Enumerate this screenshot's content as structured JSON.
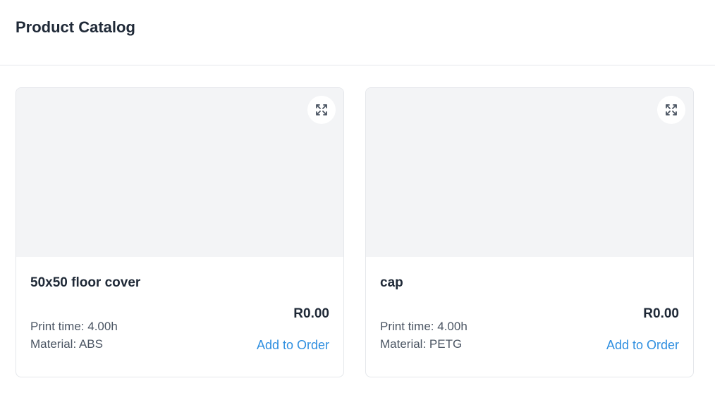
{
  "header": {
    "title": "Product Catalog"
  },
  "products": [
    {
      "name": "50x50 floor cover",
      "print_time": "Print time: 4.00h",
      "material": "Material: ABS",
      "price": "R0.00",
      "action_label": "Add to Order",
      "expand_icon": "expand-icon"
    },
    {
      "name": "cap",
      "print_time": "Print time: 4.00h",
      "material": "Material: PETG",
      "price": "R0.00",
      "action_label": "Add to Order",
      "expand_icon": "expand-icon"
    }
  ],
  "colors": {
    "accent": "#2f8fe0",
    "image_placeholder": "#f3f4f6",
    "border": "#e5e7eb",
    "text": "#1f2937",
    "muted_text": "#4b5563"
  }
}
